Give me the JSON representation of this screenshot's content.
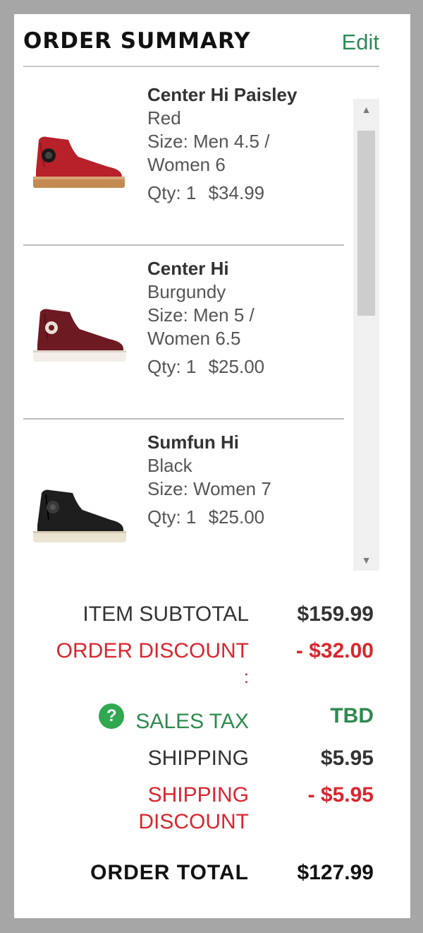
{
  "header": {
    "title": "ORDER SUMMARY",
    "edit_label": "Edit"
  },
  "items": [
    {
      "name": "Center Hi Paisley",
      "color": "Red",
      "size_line1": "Size: Men 4.5 /",
      "size_line2": "Women 6",
      "qty": "Qty: 1",
      "price": "$34.99"
    },
    {
      "name": "Center Hi",
      "color": "Burgundy",
      "size_line1": "Size: Men 5 /",
      "size_line2": "Women 6.5",
      "qty": "Qty: 1",
      "price": "$25.00"
    },
    {
      "name": "Sumfun Hi",
      "color": "Black",
      "size_line1": "Size: Women 7",
      "size_line2": "",
      "qty": "Qty: 1",
      "price": "$25.00"
    }
  ],
  "summary": {
    "subtotal_label": "ITEM SUBTOTAL",
    "subtotal_value": "$159.99",
    "discount_label": "ORDER DISCOUNT",
    "discount_colon": ":",
    "discount_value": "- $32.00",
    "tax_label": "SALES TAX",
    "tax_value": "TBD",
    "shipping_label": "SHIPPING",
    "shipping_value": "$5.95",
    "ship_discount_label1": "SHIPPING",
    "ship_discount_label2": "DISCOUNT",
    "ship_discount_value": "- $5.95",
    "total_label": "ORDER TOTAL",
    "total_value": "$127.99"
  },
  "colors": {
    "accent_green": "#2e8b57",
    "discount_red": "#d9262e",
    "tax_green": "#2f8a4f",
    "text_dark": "#333333",
    "shoe_red": "#b8202a",
    "shoe_burgundy": "#6e1a22",
    "shoe_black": "#1e1e1e"
  },
  "icons": {
    "help": "question-circle-icon",
    "scroll_up": "triangle-up-icon",
    "scroll_down": "triangle-down-icon"
  }
}
